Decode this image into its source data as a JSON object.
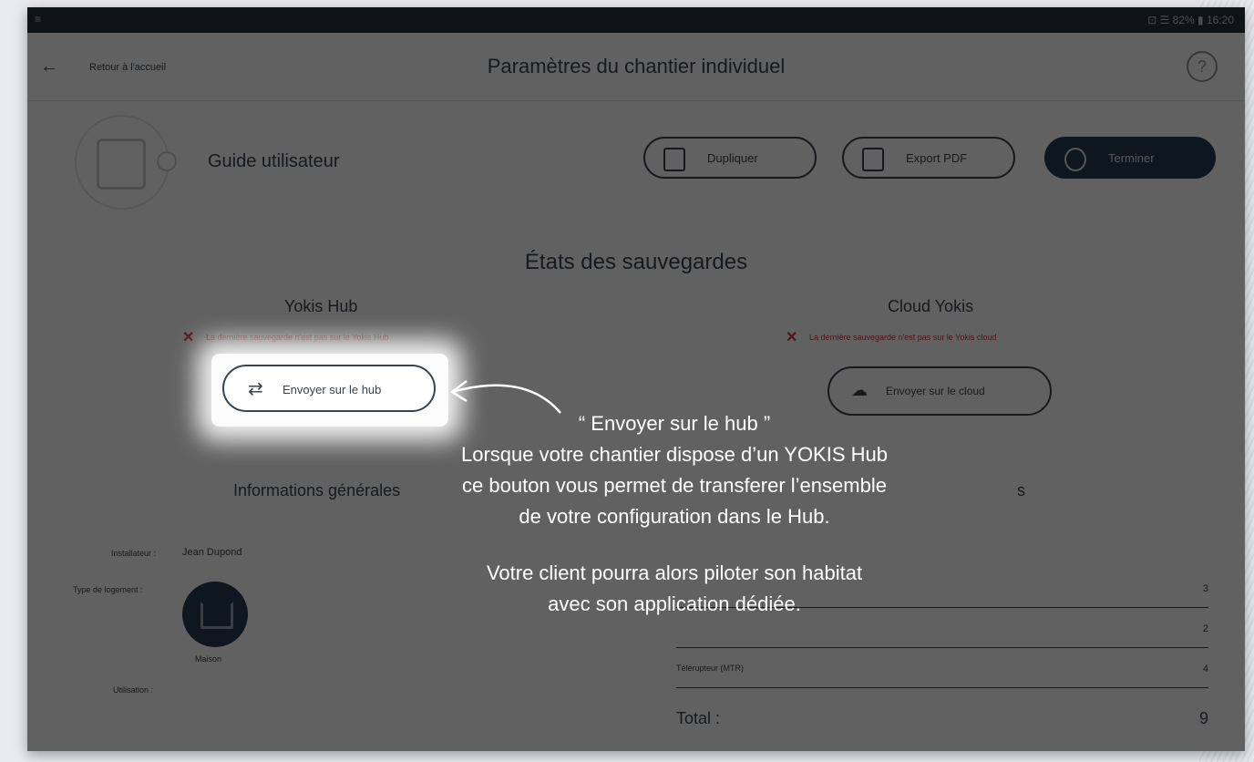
{
  "statusbar": {
    "left": "≡",
    "right": "⊡ ☰ 82% ▮ 16:20"
  },
  "appbar": {
    "back_label": "Retour à l'accueil",
    "title": "Paramètres du chantier individuel",
    "help": "?"
  },
  "project": {
    "name": "Guide utilisateur"
  },
  "toolbar": {
    "duplicate": "Dupliquer",
    "export_pdf": "Export PDF",
    "finish": "Terminer"
  },
  "backups": {
    "title": "États des sauvegardes",
    "hub": {
      "title": "Yokis Hub",
      "warning": "La dernière sauvegarde n'est pas sur le Yokis Hub",
      "button": "Envoyer sur le hub"
    },
    "cloud": {
      "title": "Cloud Yokis",
      "warning": "La dernière sauvegarde n'est pas sur le Yokis cloud",
      "button": "Envoyer sur le cloud"
    }
  },
  "info": {
    "title": "Informations générales",
    "right_title": "s",
    "installer_label": "Installateur :",
    "installer_value": "Jean Dupond",
    "type_label": "Type de logement :",
    "type_value": "Maison",
    "usage_label": "Utilisation :"
  },
  "table": {
    "rows": [
      {
        "name": "",
        "num": "3"
      },
      {
        "name": "",
        "num": "2"
      },
      {
        "name": "Télérupteur (MTR)",
        "num": "4"
      }
    ],
    "total_label": "Total :",
    "total_value": "9"
  },
  "callout": {
    "line1": "“ Envoyer sur le hub ”",
    "line2": "Lorsque votre chantier dispose d’un YOKIS Hub",
    "line3": "ce bouton vous permet de transferer l’ensemble",
    "line4": "de votre configuration dans le Hub.",
    "line5": "Votre client pourra alors piloter son habitat",
    "line6": "avec son application dédiée."
  }
}
